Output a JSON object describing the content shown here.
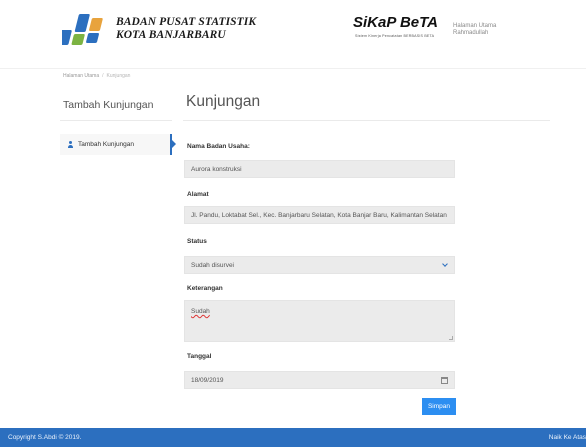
{
  "header": {
    "org_line1": "BADAN PUSAT STATISTIK",
    "org_line2": "KOTA BANJARBARU",
    "app_name": "SiKaP BeTA",
    "app_tagline": "Sistem Kinerja Pencatatan BERBASIS BETA",
    "nav_home": "Halaman Utama",
    "user_name": "Rahmadullah",
    "logo_colors": [
      "#2c6fbf",
      "#e8a33d",
      "#7cb342"
    ]
  },
  "breadcrumb": {
    "home": "Halaman Utama",
    "separator": "/",
    "current": "Kunjungan"
  },
  "sidebar": {
    "title": "Tambah Kunjungan",
    "items": [
      {
        "label": "Tambah Kunjungan",
        "icon": "user-icon",
        "active": true
      }
    ]
  },
  "main": {
    "title": "Kunjungan",
    "form": {
      "nama_label": "Nama Badan Usaha:",
      "nama_value": "Aurora konstruksi",
      "alamat_label": "Alamat",
      "alamat_value": "Jl. Pandu, Loktabat Sel., Kec. Banjarbaru Selatan, Kota Banjar Baru, Kalimantan Selatan",
      "status_label": "Status",
      "status_value": "Sudah disurvei",
      "keterangan_label": "Keterangan",
      "keterangan_value": "Sudah",
      "tanggal_label": "Tanggal",
      "tanggal_value": "18/09/2019",
      "submit_label": "Simpan"
    }
  },
  "footer": {
    "copyright": "Copyright S.Abdi © 2019.",
    "back_to_top": "Naik Ke Atas"
  },
  "colors": {
    "primary": "#2c6fbf",
    "button": "#2c8ef1",
    "field_bg": "#ebebeb"
  }
}
